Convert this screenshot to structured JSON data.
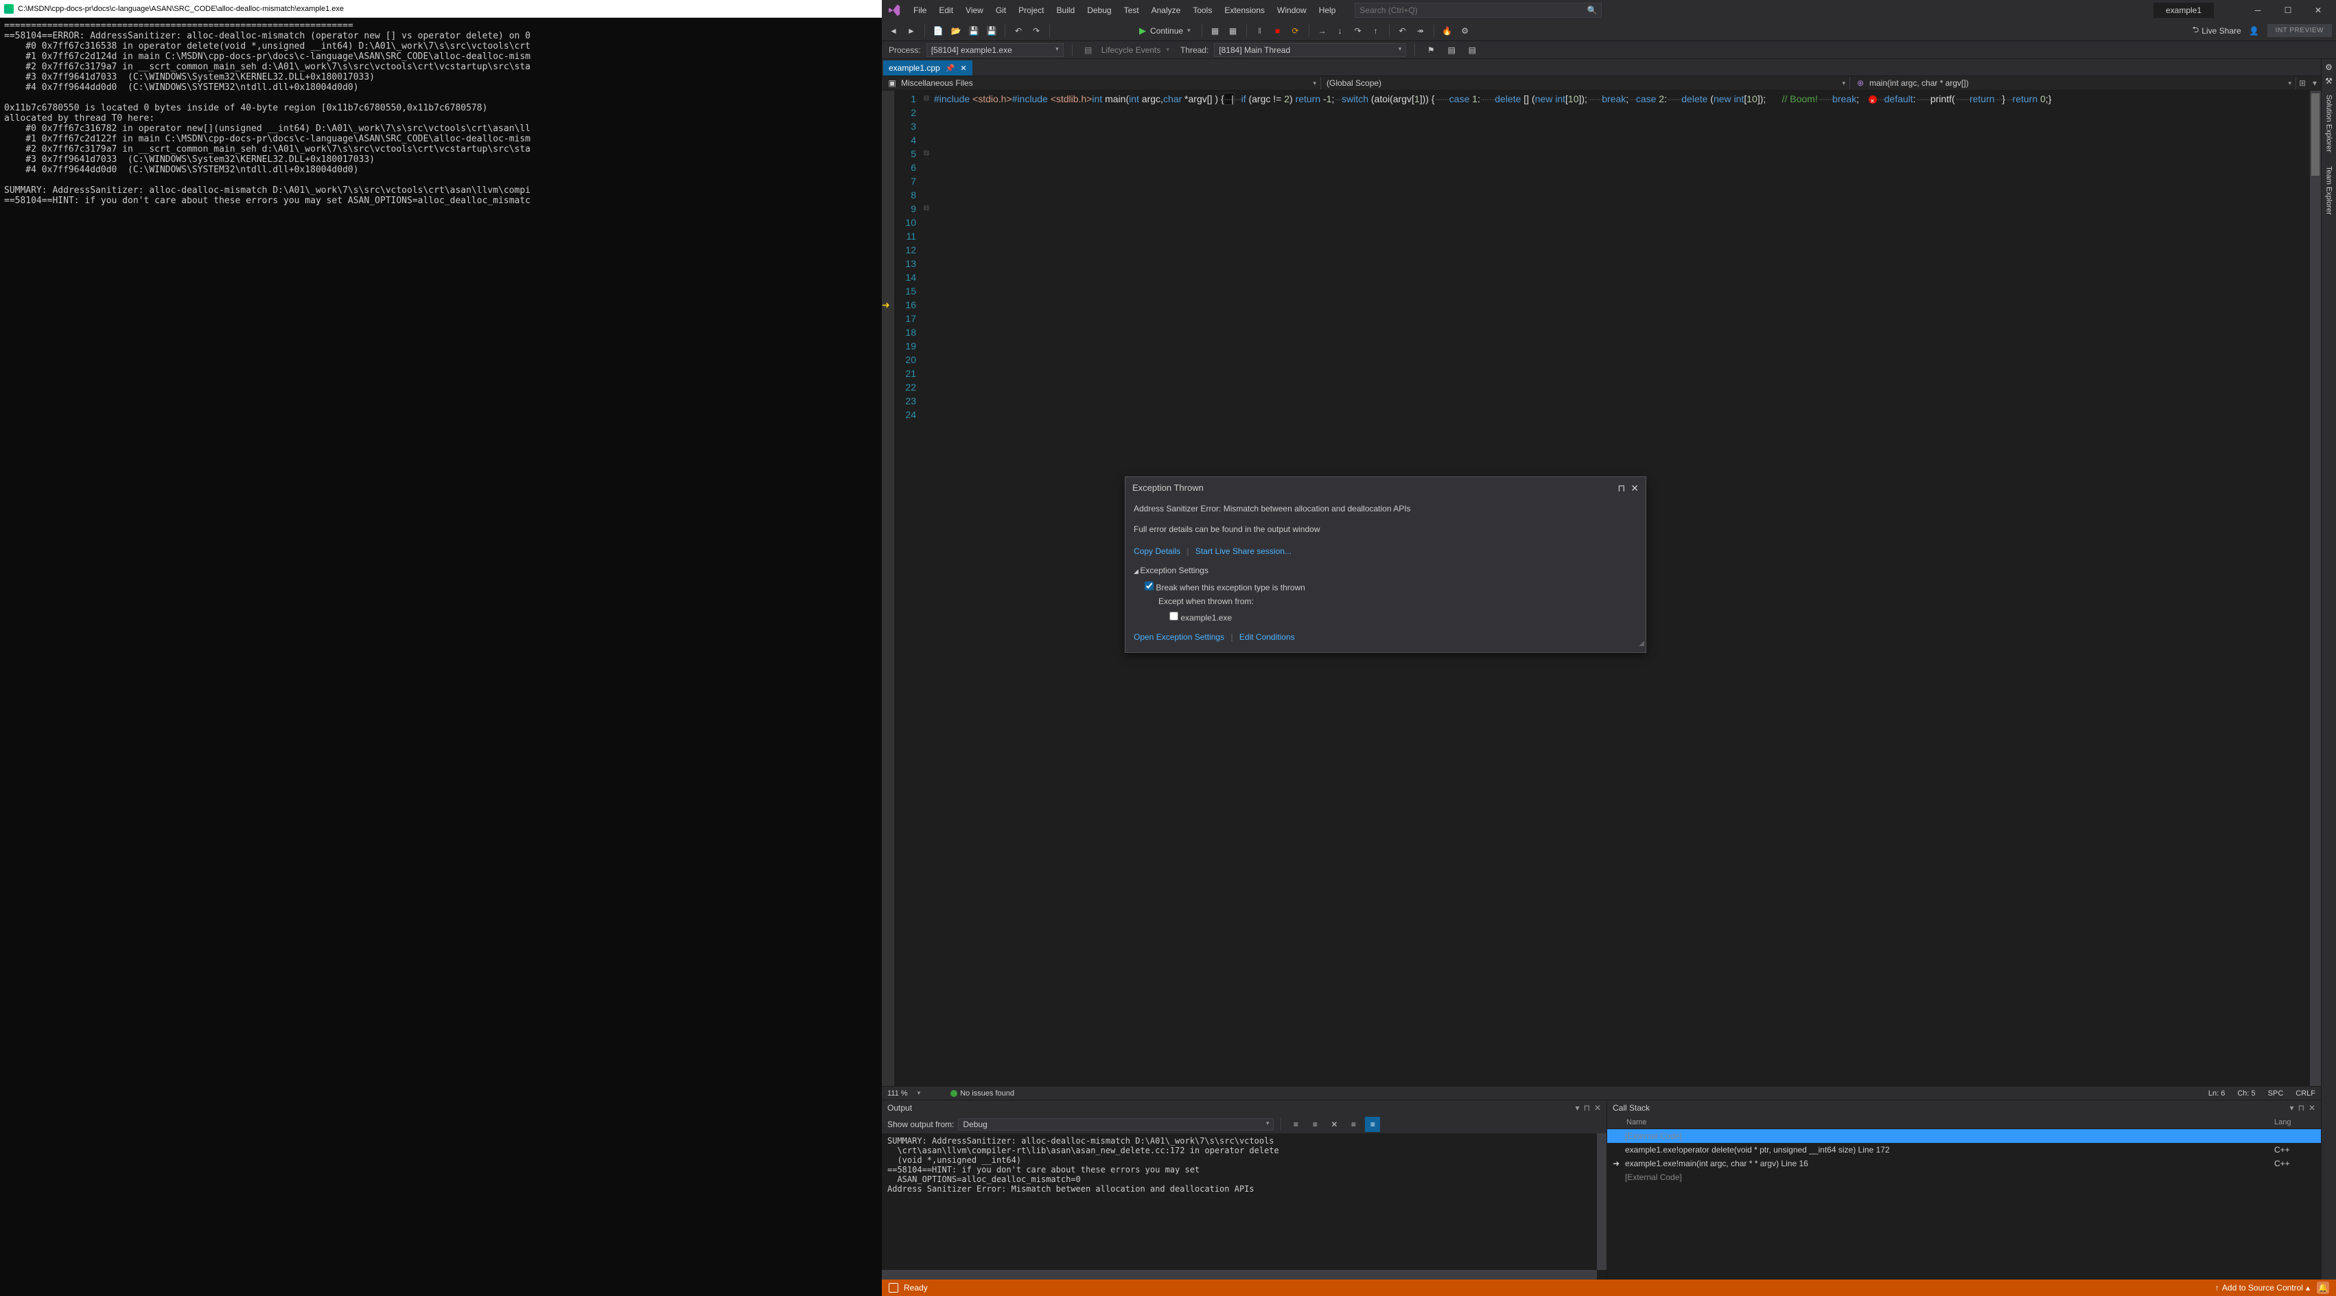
{
  "console": {
    "title": "C:\\MSDN\\cpp-docs-pr\\docs\\c-language\\ASAN\\SRC_CODE\\alloc-dealloc-mismatch\\example1.exe",
    "lines": [
      "=================================================================",
      "==58104==ERROR: AddressSanitizer: alloc-dealloc-mismatch (operator new [] vs operator delete) on 0",
      "    #0 0x7ff67c316538 in operator delete(void *,unsigned __int64) D:\\A01\\_work\\7\\s\\src\\vctools\\crt",
      "    #1 0x7ff67c2d124d in main C:\\MSDN\\cpp-docs-pr\\docs\\c-language\\ASAN\\SRC_CODE\\alloc-dealloc-mism",
      "    #2 0x7ff67c3179a7 in __scrt_common_main_seh d:\\A01\\_work\\7\\s\\src\\vctools\\crt\\vcstartup\\src\\sta",
      "    #3 0x7ff9641d7033  (C:\\WINDOWS\\System32\\KERNEL32.DLL+0x180017033)",
      "    #4 0x7ff9644dd0d0  (C:\\WINDOWS\\SYSTEM32\\ntdll.dll+0x18004d0d0)",
      "",
      "0x11b7c6780550 is located 0 bytes inside of 40-byte region [0x11b7c6780550,0x11b7c6780578)",
      "allocated by thread T0 here:",
      "    #0 0x7ff67c316782 in operator new[](unsigned __int64) D:\\A01\\_work\\7\\s\\src\\vctools\\crt\\asan\\ll",
      "    #1 0x7ff67c2d122f in main C:\\MSDN\\cpp-docs-pr\\docs\\c-language\\ASAN\\SRC_CODE\\alloc-dealloc-mism",
      "    #2 0x7ff67c3179a7 in __scrt_common_main_seh d:\\A01\\_work\\7\\s\\src\\vctools\\crt\\vcstartup\\src\\sta",
      "    #3 0x7ff9641d7033  (C:\\WINDOWS\\System32\\KERNEL32.DLL+0x180017033)",
      "    #4 0x7ff9644dd0d0  (C:\\WINDOWS\\SYSTEM32\\ntdll.dll+0x18004d0d0)",
      "",
      "SUMMARY: AddressSanitizer: alloc-dealloc-mismatch D:\\A01\\_work\\7\\s\\src\\vctools\\crt\\asan\\llvm\\compi",
      "==58104==HINT: if you don't care about these errors you may set ASAN_OPTIONS=alloc_dealloc_mismatc"
    ]
  },
  "vs": {
    "menu": [
      "File",
      "Edit",
      "View",
      "Git",
      "Project",
      "Build",
      "Debug",
      "Test",
      "Analyze",
      "Tools",
      "Extensions",
      "Window",
      "Help"
    ],
    "search_placeholder": "Search (Ctrl+Q)",
    "doc_name": "example1",
    "toolbar": {
      "continue": "Continue",
      "liveshare": "Live Share",
      "int_preview": "INT PREVIEW"
    },
    "procbar": {
      "process_label": "Process:",
      "process_value": "[58104] example1.exe",
      "lifecycle": "Lifecycle Events",
      "thread_label": "Thread:",
      "thread_value": "[8184] Main Thread"
    },
    "tabs": {
      "file": "example1.cpp"
    },
    "nav": {
      "left": "Miscellaneous Files",
      "mid": "(Global Scope)",
      "right": "main(int argc, char * argv[])"
    },
    "vtabs": [
      "Solution Explorer",
      "Team Explorer"
    ],
    "status": {
      "zoom": "111 %",
      "issues": "No issues found",
      "ln": "Ln: 6",
      "ch": "Ch: 5",
      "spc": "SPC",
      "crlf": "CRLF"
    },
    "exception": {
      "title": "Exception Thrown",
      "msg1": "Address Sanitizer Error: Mismatch between allocation and deallocation APIs",
      "msg2": "Full error details can be found in the output window",
      "copy": "Copy Details",
      "liveshare": "Start Live Share session...",
      "settings_hdr": "Exception Settings",
      "break_label": "Break when this exception type is thrown",
      "except_label": "Except when thrown from:",
      "except_item": "example1.exe",
      "open_settings": "Open Exception Settings",
      "edit_cond": "Edit Conditions"
    },
    "output": {
      "title": "Output",
      "show_label": "Show output from:",
      "source": "Debug",
      "lines": [
        "SUMMARY: AddressSanitizer: alloc-dealloc-mismatch D:\\A01\\_work\\7\\s\\src\\vctools",
        "  \\crt\\asan\\llvm\\compiler-rt\\lib\\asan\\asan_new_delete.cc:172 in operator delete",
        "  (void *,unsigned __int64)",
        "==58104==HINT: if you don't care about these errors you may set",
        "  ASAN_OPTIONS=alloc_dealloc_mismatch=0",
        "Address Sanitizer Error: Mismatch between allocation and deallocation APIs"
      ]
    },
    "callstack": {
      "title": "Call Stack",
      "col_name": "Name",
      "col_lang": "Lang",
      "rows": [
        {
          "name": "[External Code]",
          "lang": "",
          "dim": true,
          "sel": true
        },
        {
          "name": "example1.exe!operator delete(void * ptr, unsigned __int64 size) Line 172",
          "lang": "C++",
          "dim": false
        },
        {
          "name": "example1.exe!main(int argc, char * * argv) Line 16",
          "lang": "C++",
          "dim": false,
          "arrow": true
        },
        {
          "name": "[External Code]",
          "lang": "",
          "dim": true
        }
      ]
    },
    "statusbar": {
      "ready": "Ready",
      "src_ctrl": "Add to Source Control"
    }
  }
}
